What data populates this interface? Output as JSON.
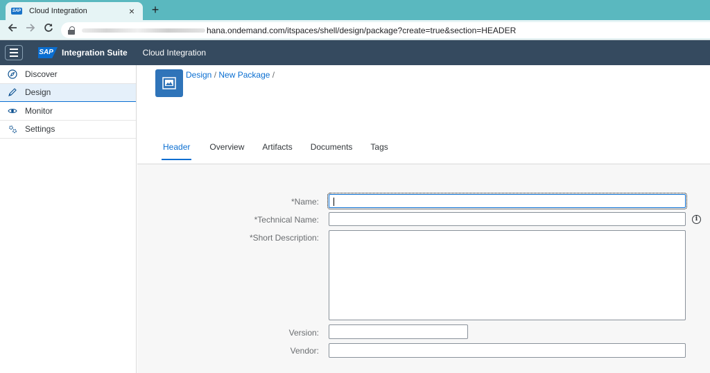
{
  "browser": {
    "tab_title": "Cloud Integration",
    "tab_close": "×",
    "new_tab": "+",
    "url_visible": "hana.ondemand.com/itspaces/shell/design/package?create=true&section=HEADER"
  },
  "shell": {
    "logo": "SAP",
    "product": "Integration Suite",
    "app_title": "Cloud Integration"
  },
  "sidenav": {
    "items": [
      {
        "label": "Discover",
        "icon": "compass-icon"
      },
      {
        "label": "Design",
        "icon": "pencil-icon"
      },
      {
        "label": "Monitor",
        "icon": "eye-icon"
      },
      {
        "label": "Settings",
        "icon": "gears-icon"
      }
    ],
    "selected": "Design"
  },
  "breadcrumb": {
    "design": "Design",
    "sep1": " / ",
    "new_package": "New Package",
    "sep2": " /"
  },
  "tabs": [
    "Header",
    "Overview",
    "Artifacts",
    "Documents",
    "Tags"
  ],
  "active_tab": "Header",
  "form": {
    "name_label": "*Name:",
    "technical_name_label": "*Technical Name:",
    "short_description_label": "*Short Description:",
    "version_label": "Version:",
    "vendor_label": "Vendor:",
    "name_value": "",
    "technical_name_value": "",
    "short_description_value": "",
    "version_value": "",
    "vendor_value": "",
    "info_glyph": "i"
  },
  "colors": {
    "shell_bar": "#354a5f",
    "accent": "#0a6ed1",
    "browser_teal": "#5ab8bf"
  }
}
